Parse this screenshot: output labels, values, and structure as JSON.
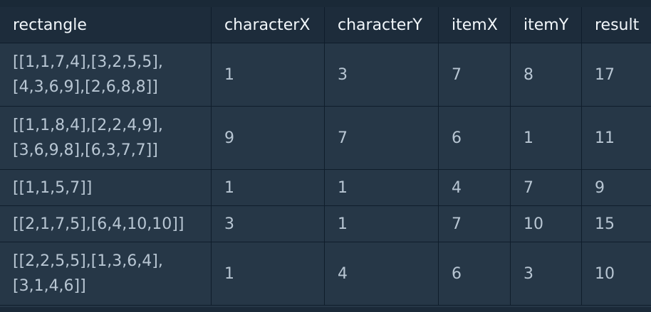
{
  "table": {
    "headers": [
      "rectangle",
      "characterX",
      "characterY",
      "itemX",
      "itemY",
      "result"
    ],
    "rows": [
      [
        "[[1,1,7,4],[3,2,5,5],\n[4,3,6,9],[2,6,8,8]]",
        "1",
        "3",
        "7",
        "8",
        "17"
      ],
      [
        "[[1,1,8,4],[2,2,4,9],\n[3,6,9,8],[6,3,7,7]]",
        "9",
        "7",
        "6",
        "1",
        "11"
      ],
      [
        "[[1,1,5,7]]",
        "1",
        "1",
        "4",
        "7",
        "9"
      ],
      [
        "[[2,1,7,5],[6,4,10,10]]",
        "3",
        "1",
        "7",
        "10",
        "15"
      ],
      [
        "[[2,2,5,5],[1,3,6,4],\n[3,1,4,6]]",
        "1",
        "4",
        "6",
        "3",
        "10"
      ]
    ]
  }
}
